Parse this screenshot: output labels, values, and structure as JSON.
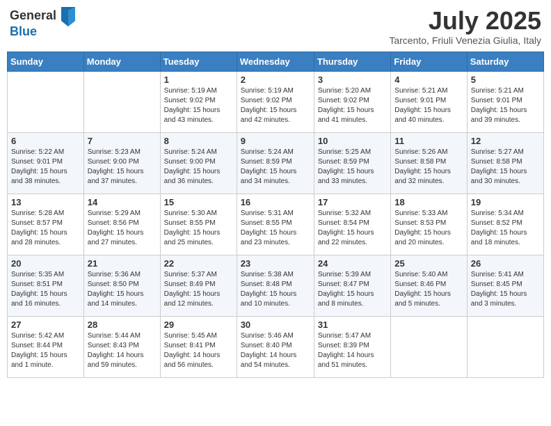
{
  "logo": {
    "general": "General",
    "blue": "Blue"
  },
  "title": {
    "month_year": "July 2025",
    "location": "Tarcento, Friuli Venezia Giulia, Italy"
  },
  "days_of_week": [
    "Sunday",
    "Monday",
    "Tuesday",
    "Wednesday",
    "Thursday",
    "Friday",
    "Saturday"
  ],
  "weeks": [
    [
      {
        "day": "",
        "info": ""
      },
      {
        "day": "",
        "info": ""
      },
      {
        "day": "1",
        "info": "Sunrise: 5:19 AM\nSunset: 9:02 PM\nDaylight: 15 hours\nand 43 minutes."
      },
      {
        "day": "2",
        "info": "Sunrise: 5:19 AM\nSunset: 9:02 PM\nDaylight: 15 hours\nand 42 minutes."
      },
      {
        "day": "3",
        "info": "Sunrise: 5:20 AM\nSunset: 9:02 PM\nDaylight: 15 hours\nand 41 minutes."
      },
      {
        "day": "4",
        "info": "Sunrise: 5:21 AM\nSunset: 9:01 PM\nDaylight: 15 hours\nand 40 minutes."
      },
      {
        "day": "5",
        "info": "Sunrise: 5:21 AM\nSunset: 9:01 PM\nDaylight: 15 hours\nand 39 minutes."
      }
    ],
    [
      {
        "day": "6",
        "info": "Sunrise: 5:22 AM\nSunset: 9:01 PM\nDaylight: 15 hours\nand 38 minutes."
      },
      {
        "day": "7",
        "info": "Sunrise: 5:23 AM\nSunset: 9:00 PM\nDaylight: 15 hours\nand 37 minutes."
      },
      {
        "day": "8",
        "info": "Sunrise: 5:24 AM\nSunset: 9:00 PM\nDaylight: 15 hours\nand 36 minutes."
      },
      {
        "day": "9",
        "info": "Sunrise: 5:24 AM\nSunset: 8:59 PM\nDaylight: 15 hours\nand 34 minutes."
      },
      {
        "day": "10",
        "info": "Sunrise: 5:25 AM\nSunset: 8:59 PM\nDaylight: 15 hours\nand 33 minutes."
      },
      {
        "day": "11",
        "info": "Sunrise: 5:26 AM\nSunset: 8:58 PM\nDaylight: 15 hours\nand 32 minutes."
      },
      {
        "day": "12",
        "info": "Sunrise: 5:27 AM\nSunset: 8:58 PM\nDaylight: 15 hours\nand 30 minutes."
      }
    ],
    [
      {
        "day": "13",
        "info": "Sunrise: 5:28 AM\nSunset: 8:57 PM\nDaylight: 15 hours\nand 28 minutes."
      },
      {
        "day": "14",
        "info": "Sunrise: 5:29 AM\nSunset: 8:56 PM\nDaylight: 15 hours\nand 27 minutes."
      },
      {
        "day": "15",
        "info": "Sunrise: 5:30 AM\nSunset: 8:55 PM\nDaylight: 15 hours\nand 25 minutes."
      },
      {
        "day": "16",
        "info": "Sunrise: 5:31 AM\nSunset: 8:55 PM\nDaylight: 15 hours\nand 23 minutes."
      },
      {
        "day": "17",
        "info": "Sunrise: 5:32 AM\nSunset: 8:54 PM\nDaylight: 15 hours\nand 22 minutes."
      },
      {
        "day": "18",
        "info": "Sunrise: 5:33 AM\nSunset: 8:53 PM\nDaylight: 15 hours\nand 20 minutes."
      },
      {
        "day": "19",
        "info": "Sunrise: 5:34 AM\nSunset: 8:52 PM\nDaylight: 15 hours\nand 18 minutes."
      }
    ],
    [
      {
        "day": "20",
        "info": "Sunrise: 5:35 AM\nSunset: 8:51 PM\nDaylight: 15 hours\nand 16 minutes."
      },
      {
        "day": "21",
        "info": "Sunrise: 5:36 AM\nSunset: 8:50 PM\nDaylight: 15 hours\nand 14 minutes."
      },
      {
        "day": "22",
        "info": "Sunrise: 5:37 AM\nSunset: 8:49 PM\nDaylight: 15 hours\nand 12 minutes."
      },
      {
        "day": "23",
        "info": "Sunrise: 5:38 AM\nSunset: 8:48 PM\nDaylight: 15 hours\nand 10 minutes."
      },
      {
        "day": "24",
        "info": "Sunrise: 5:39 AM\nSunset: 8:47 PM\nDaylight: 15 hours\nand 8 minutes."
      },
      {
        "day": "25",
        "info": "Sunrise: 5:40 AM\nSunset: 8:46 PM\nDaylight: 15 hours\nand 5 minutes."
      },
      {
        "day": "26",
        "info": "Sunrise: 5:41 AM\nSunset: 8:45 PM\nDaylight: 15 hours\nand 3 minutes."
      }
    ],
    [
      {
        "day": "27",
        "info": "Sunrise: 5:42 AM\nSunset: 8:44 PM\nDaylight: 15 hours\nand 1 minute."
      },
      {
        "day": "28",
        "info": "Sunrise: 5:44 AM\nSunset: 8:43 PM\nDaylight: 14 hours\nand 59 minutes."
      },
      {
        "day": "29",
        "info": "Sunrise: 5:45 AM\nSunset: 8:41 PM\nDaylight: 14 hours\nand 56 minutes."
      },
      {
        "day": "30",
        "info": "Sunrise: 5:46 AM\nSunset: 8:40 PM\nDaylight: 14 hours\nand 54 minutes."
      },
      {
        "day": "31",
        "info": "Sunrise: 5:47 AM\nSunset: 8:39 PM\nDaylight: 14 hours\nand 51 minutes."
      },
      {
        "day": "",
        "info": ""
      },
      {
        "day": "",
        "info": ""
      }
    ]
  ]
}
